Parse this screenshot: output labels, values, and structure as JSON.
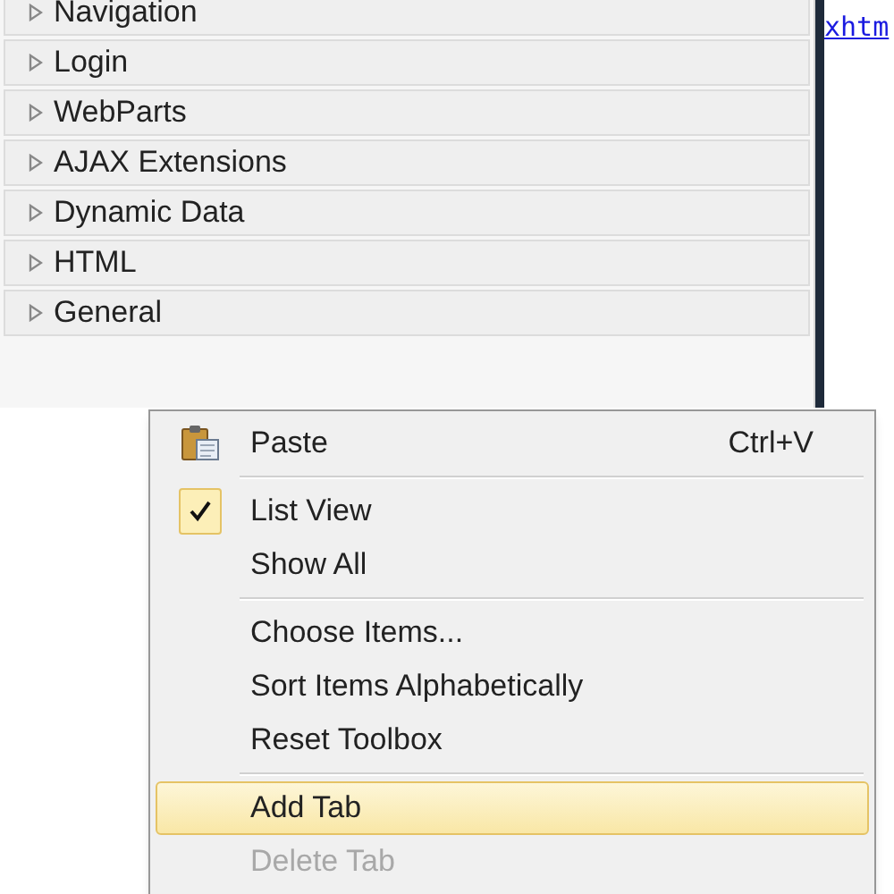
{
  "toolbox": {
    "groups": [
      {
        "label": "Navigation",
        "expanded": false
      },
      {
        "label": "Login",
        "expanded": false
      },
      {
        "label": "WebParts",
        "expanded": false
      },
      {
        "label": "AJAX Extensions",
        "expanded": false
      },
      {
        "label": "Dynamic Data",
        "expanded": false
      },
      {
        "label": "HTML",
        "expanded": false
      },
      {
        "label": "General",
        "expanded": false
      }
    ]
  },
  "editor": {
    "text": "xhtm"
  },
  "context_menu": {
    "items": [
      {
        "kind": "icon_item",
        "label": "Paste",
        "shortcut": "Ctrl+V",
        "checked": false,
        "selected": false,
        "disabled": false
      },
      {
        "kind": "separator"
      },
      {
        "kind": "item",
        "label": "List View",
        "checked": true,
        "selected": false,
        "disabled": false
      },
      {
        "kind": "item",
        "label": "Show All",
        "checked": false,
        "selected": false,
        "disabled": false
      },
      {
        "kind": "separator"
      },
      {
        "kind": "item",
        "label": "Choose Items...",
        "checked": false,
        "selected": false,
        "disabled": false
      },
      {
        "kind": "item",
        "label": "Sort Items Alphabetically",
        "checked": false,
        "selected": false,
        "disabled": false
      },
      {
        "kind": "item",
        "label": "Reset Toolbox",
        "checked": false,
        "selected": false,
        "disabled": false
      },
      {
        "kind": "separator"
      },
      {
        "kind": "item",
        "label": "Add Tab",
        "checked": false,
        "selected": true,
        "disabled": false
      },
      {
        "kind": "item",
        "label": "Delete Tab",
        "checked": false,
        "selected": false,
        "disabled": true
      }
    ]
  }
}
